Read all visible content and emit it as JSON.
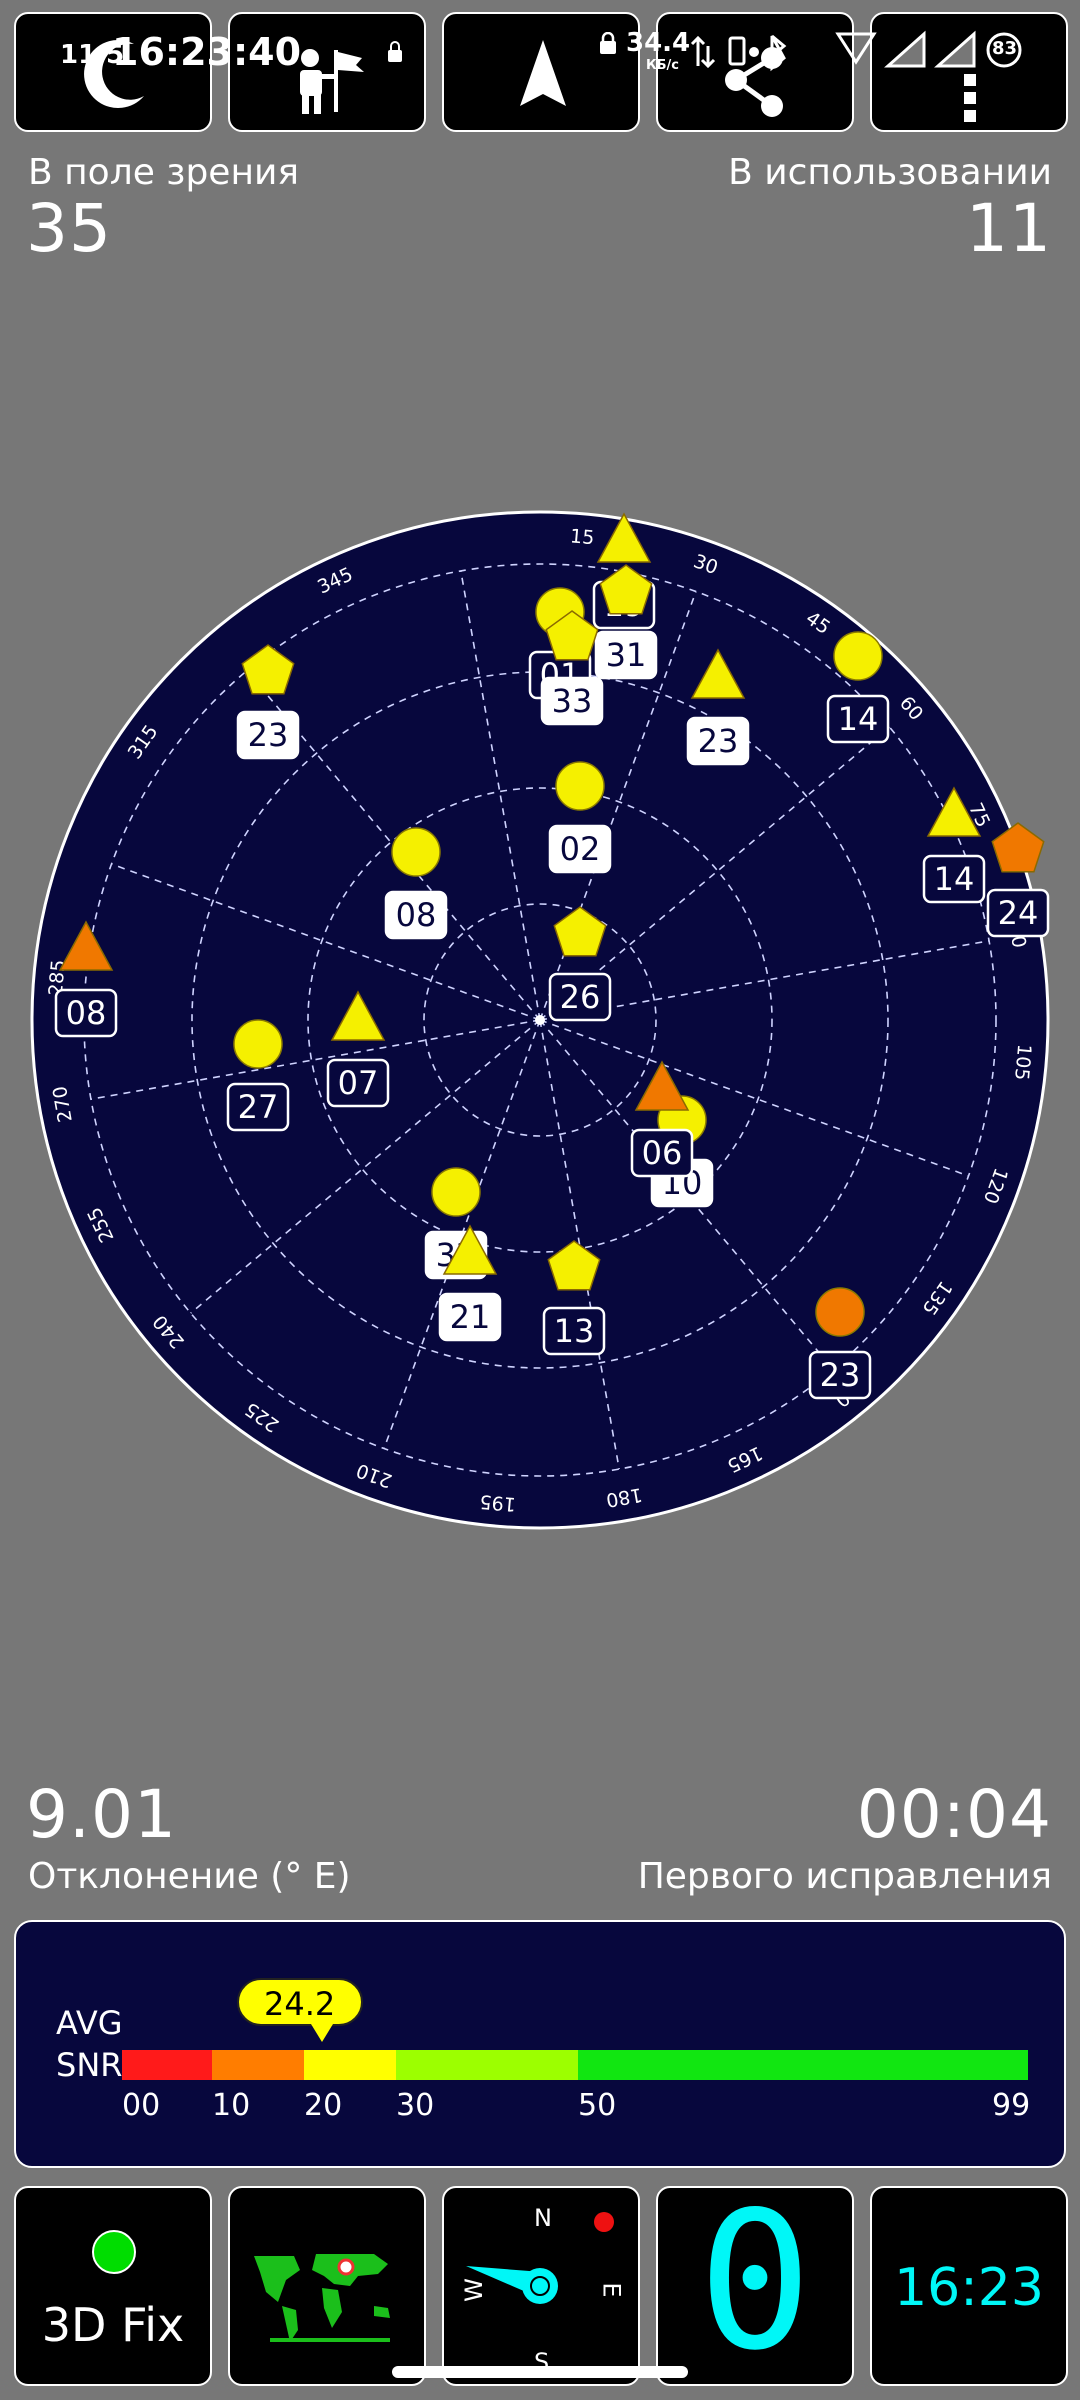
{
  "status_bar": {
    "time_prefix": "11·5",
    "time": "16:23:40",
    "net_speed": "34.4",
    "net_unit": "КБ/с",
    "battery": "83"
  },
  "top_tiles": [
    {
      "name": "night-mode-tile",
      "icon": "moon-icon"
    },
    {
      "name": "map-mode-tile",
      "icon": "flag-person-icon"
    },
    {
      "name": "navigation-tile",
      "icon": "navigation-arrow-icon"
    },
    {
      "name": "share-tile",
      "icon": "share-icon"
    },
    {
      "name": "menu-tile",
      "icon": "more-vertical-icon"
    }
  ],
  "stats": {
    "in_view_label": "В поле зрения",
    "in_view_value": "35",
    "in_use_label": "В использовании",
    "in_use_value": "11",
    "declination_value": "9.01",
    "declination_label": "Отклонение (° E)",
    "ttff_value": "00:04",
    "ttff_label": "Первого исправления"
  },
  "radar": {
    "bg_color": "#07073d",
    "azimuth_labels": [
      "285",
      "315",
      "345",
      "15",
      "30",
      "45",
      "60",
      "75",
      "90",
      "105",
      "120",
      "135",
      "150",
      "165",
      "180",
      "195",
      "210",
      "225",
      "240",
      "255",
      "270"
    ],
    "satellites": [
      {
        "id": "19",
        "shape": "triangle",
        "color": "#f5f000",
        "filled": false
      },
      {
        "id": "31",
        "shape": "pentagon",
        "color": "#f5f000",
        "filled": true
      },
      {
        "id": "01",
        "shape": "circle",
        "color": "#f5f000",
        "filled": false
      },
      {
        "id": "33",
        "shape": "pentagon",
        "color": "#f5f000",
        "filled": true
      },
      {
        "id": "23",
        "shape": "triangle",
        "color": "#f5f000",
        "filled": true
      },
      {
        "id": "14",
        "shape": "circle",
        "color": "#f5f000",
        "filled": false
      },
      {
        "id": "14",
        "shape": "triangle",
        "color": "#f5f000",
        "filled": false
      },
      {
        "id": "24",
        "shape": "pentagon",
        "color": "#f07800",
        "filled": false
      },
      {
        "id": "23",
        "shape": "pentagon",
        "color": "#f5f000",
        "filled": true
      },
      {
        "id": "02",
        "shape": "circle",
        "color": "#f5f000",
        "filled": true
      },
      {
        "id": "08",
        "shape": "circle",
        "color": "#f5f000",
        "filled": true
      },
      {
        "id": "26",
        "shape": "pentagon",
        "color": "#f5f000",
        "filled": false
      },
      {
        "id": "08",
        "shape": "triangle",
        "color": "#f07800",
        "filled": false
      },
      {
        "id": "27",
        "shape": "circle",
        "color": "#f5f000",
        "filled": false
      },
      {
        "id": "07",
        "shape": "triangle",
        "color": "#f5f000",
        "filled": false
      },
      {
        "id": "10",
        "shape": "circle",
        "color": "#f5f000",
        "filled": true
      },
      {
        "id": "06",
        "shape": "triangle",
        "color": "#f07800",
        "filled": false
      },
      {
        "id": "32",
        "shape": "circle",
        "color": "#f5f000",
        "filled": true
      },
      {
        "id": "21",
        "shape": "triangle",
        "color": "#f5f000",
        "filled": true
      },
      {
        "id": "13",
        "shape": "pentagon",
        "color": "#f5f000",
        "filled": false
      },
      {
        "id": "23",
        "shape": "circle",
        "color": "#f07800",
        "filled": false
      }
    ]
  },
  "snr": {
    "avg_label": "AVG",
    "snr_label": "SNR",
    "value": "24.2",
    "value_num": 24.2,
    "ticks": [
      "00",
      "10",
      "20",
      "30",
      "50",
      "99"
    ],
    "segments": [
      {
        "from": 0,
        "to": 10,
        "color": "#ff1a1a"
      },
      {
        "from": 10,
        "to": 20,
        "color": "#ff7d00"
      },
      {
        "from": 20,
        "to": 30,
        "color": "#ffff00"
      },
      {
        "from": 30,
        "to": 50,
        "color": "#9cff00"
      },
      {
        "from": 50,
        "to": 99,
        "color": "#11e611"
      }
    ]
  },
  "bottom_tiles": {
    "fix_label": "3D Fix",
    "compass": {
      "n": "N",
      "e": "E",
      "s": "S",
      "w": "W"
    },
    "speed": "0",
    "clock": "16:23"
  },
  "colors": {
    "accent_cyan": "#00f7f7",
    "fix_green": "#00dd00"
  }
}
